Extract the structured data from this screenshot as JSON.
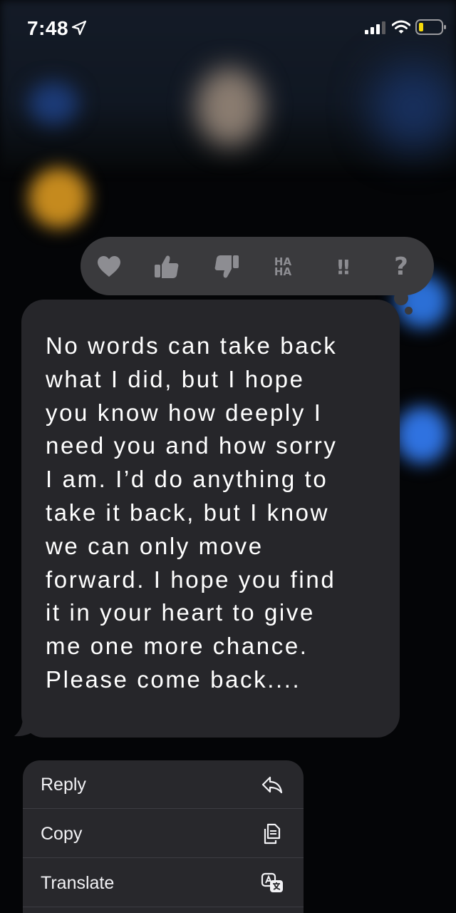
{
  "status_bar": {
    "time": "7:48",
    "location_icon": "location-arrow-icon",
    "signal_icon": "cellular-signal-icon",
    "wifi_icon": "wifi-icon",
    "battery_icon": "battery-low-icon",
    "battery_color": "#f5d90a"
  },
  "tapback": {
    "items": [
      {
        "name": "heart",
        "icon": "heart-icon"
      },
      {
        "name": "like",
        "icon": "thumbs-up-icon"
      },
      {
        "name": "dislike",
        "icon": "thumbs-down-icon"
      },
      {
        "name": "haha",
        "line1": "HA",
        "line2": "HA"
      },
      {
        "name": "emphasize",
        "glyph": "!!"
      },
      {
        "name": "question",
        "glyph": "?"
      }
    ],
    "background": "#3a3a3d",
    "icon_color": "#8d8d92"
  },
  "message": {
    "text": "No words can take back\nwhat I did, but I hope\nyou know how deeply I\nneed you and how sorry\nI am.  I’d do anything to\ntake it back, but I know\nwe can only move\nforward. I hope you find\nit in your heart to give\nme one more chance.\nPlease come back....",
    "bubble_color": "#26262a"
  },
  "context_menu": {
    "items": [
      {
        "label": "Reply",
        "icon": "reply-arrow-icon"
      },
      {
        "label": "Copy",
        "icon": "copy-icon"
      },
      {
        "label": "Translate",
        "icon": "translate-icon"
      }
    ]
  }
}
